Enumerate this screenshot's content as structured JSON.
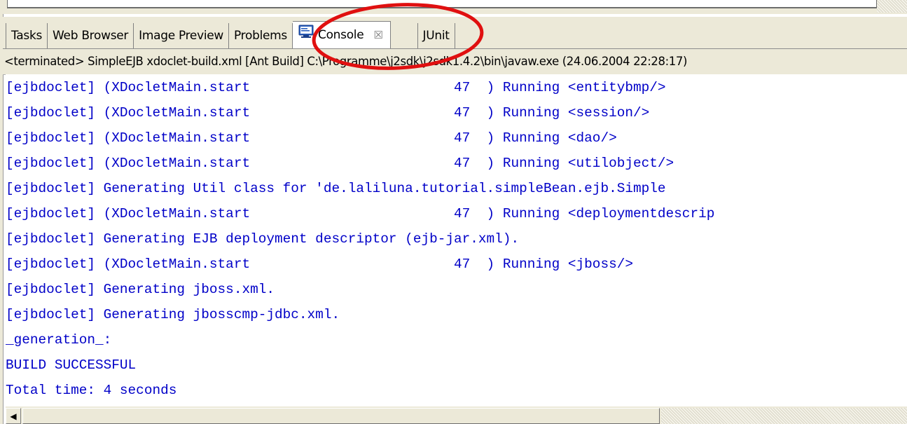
{
  "tabs": {
    "tasks": "Tasks",
    "web_browser": "Web Browser",
    "image_preview": "Image Preview",
    "problems": "Problems",
    "console": "Console",
    "console_close": "☒",
    "junit": "JUnit"
  },
  "status_line": "<terminated> SimpleEJB xdoclet-build.xml [Ant Build] C:\\Programme\\j2sdk\\j2sdk1.4.2\\bin\\javaw.exe (24.06.2004 22:28:17)",
  "console": {
    "lines": [
      "[ejbdoclet] (XDocletMain.start                         47  ) Running <entitybmp/>",
      "[ejbdoclet] (XDocletMain.start                         47  ) Running <session/>",
      "[ejbdoclet] (XDocletMain.start                         47  ) Running <dao/>",
      "[ejbdoclet] (XDocletMain.start                         47  ) Running <utilobject/>",
      "[ejbdoclet] Generating Util class for 'de.laliluna.tutorial.simpleBean.ejb.Simple",
      "[ejbdoclet] (XDocletMain.start                         47  ) Running <deploymentdescrip",
      "[ejbdoclet] Generating EJB deployment descriptor (ejb-jar.xml).",
      "[ejbdoclet] (XDocletMain.start                         47  ) Running <jboss/>",
      "[ejbdoclet] Generating jboss.xml.",
      "[ejbdoclet] Generating jbosscmp-jdbc.xml.",
      "_generation_:",
      "BUILD SUCCESSFUL",
      "Total time: 4 seconds"
    ]
  },
  "icons": {
    "console_icon": "console-icon",
    "close_icon": "close-icon",
    "scroll_left_icon": "arrow-left-icon"
  },
  "colors": {
    "console_text": "#0000c8",
    "annotation": "#e01010",
    "chrome": "#ece9d8"
  }
}
